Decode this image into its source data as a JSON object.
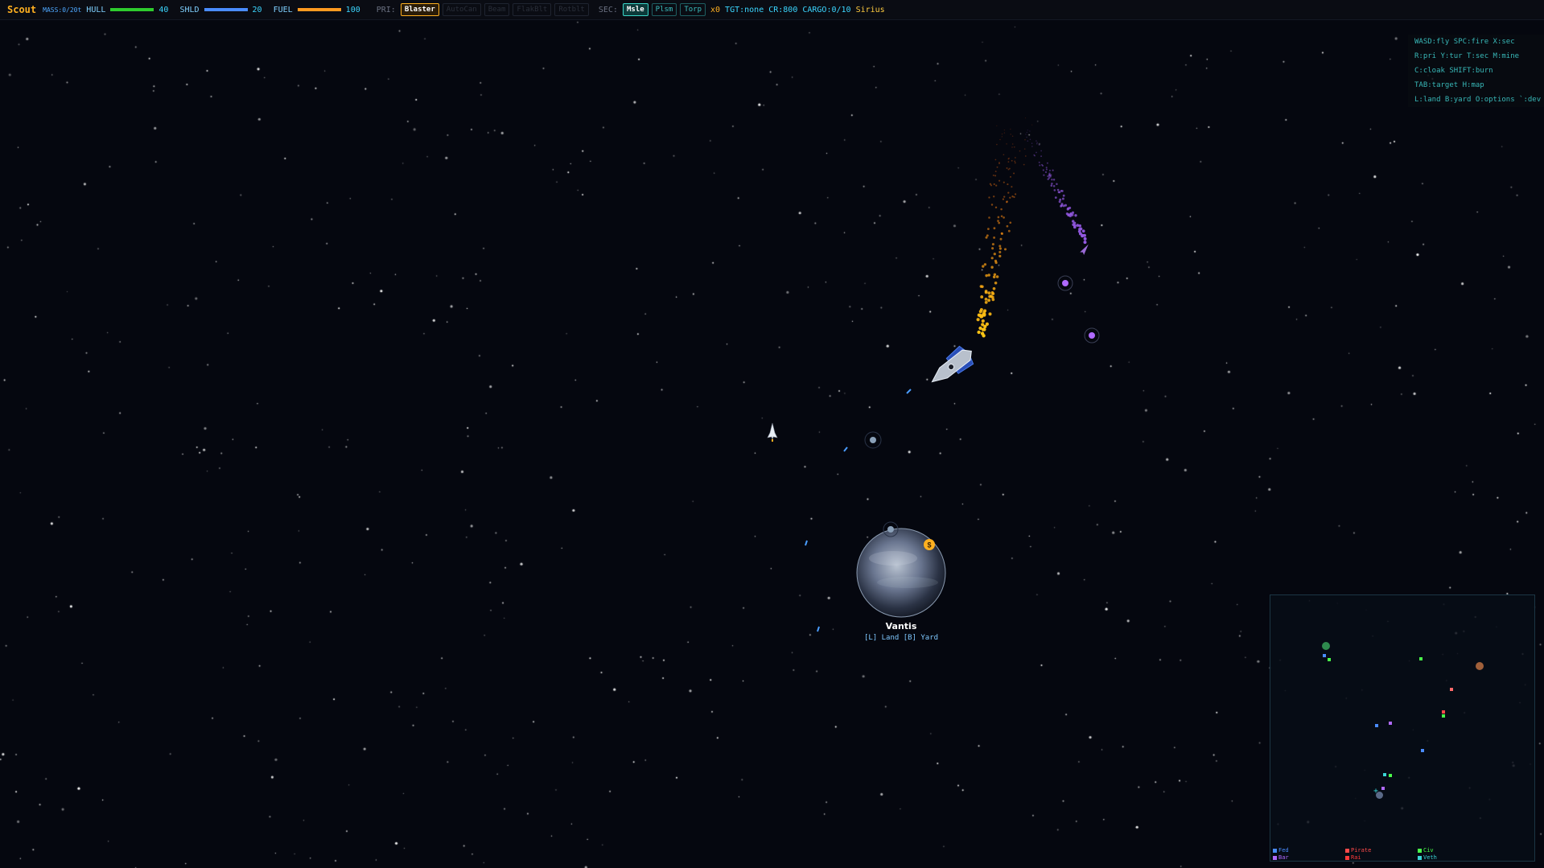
{
  "hud": {
    "ship_name": "Scout",
    "mass": "MASS:0/20t",
    "hull_label": "HULL",
    "hull_value": "40",
    "hull_fill": 1.0,
    "hull_color": "#2ecc2e",
    "shield_label": "SHLD",
    "shield_value": "20",
    "shield_fill": 1.0,
    "shield_color": "#4a8cff",
    "fuel_label": "FUEL",
    "fuel_value": "100",
    "fuel_fill": 1.0,
    "fuel_color": "#ff9a20",
    "primary_label": "PRI:",
    "primary_weapons": [
      "Blaster",
      "AutoCan",
      "Beam",
      "FlakBlt",
      "Rotblt"
    ],
    "primary_active": "Blaster",
    "secondary_label": "SEC:",
    "secondary_weapons": [
      "Msle",
      "Plsm",
      "Torp"
    ],
    "secondary_active": "Msle",
    "ammo": "x0",
    "target": "TGT:none",
    "credits": "CR:800",
    "cargo": "CARGO:0/10",
    "system": "Sirius"
  },
  "help": [
    "WASD:fly SPC:fire X:sec",
    "R:pri Y:tur T:sec M:mine",
    "C:cloak SHIFT:burn",
    "TAB:target H:map",
    "L:land B:yard O:options `:dev"
  ],
  "planet": {
    "name": "Vantis",
    "actions": "[L] Land [B] Yard",
    "badge": "$"
  },
  "minimap": {
    "legend": [
      {
        "label": "Fed",
        "color": "#4a8cff"
      },
      {
        "label": "Pirate",
        "color": "#ff4a4a"
      },
      {
        "label": "Civ",
        "color": "#4aff4a"
      },
      {
        "label": "Bar",
        "color": "#b06aff"
      },
      {
        "label": "Rai",
        "color": "#ff3a3a"
      },
      {
        "label": "Veth",
        "color": "#3ad6d6"
      }
    ]
  },
  "colors": {
    "background": "#05070f",
    "accent": "#ffb020",
    "cyan": "#3bd6ff"
  }
}
